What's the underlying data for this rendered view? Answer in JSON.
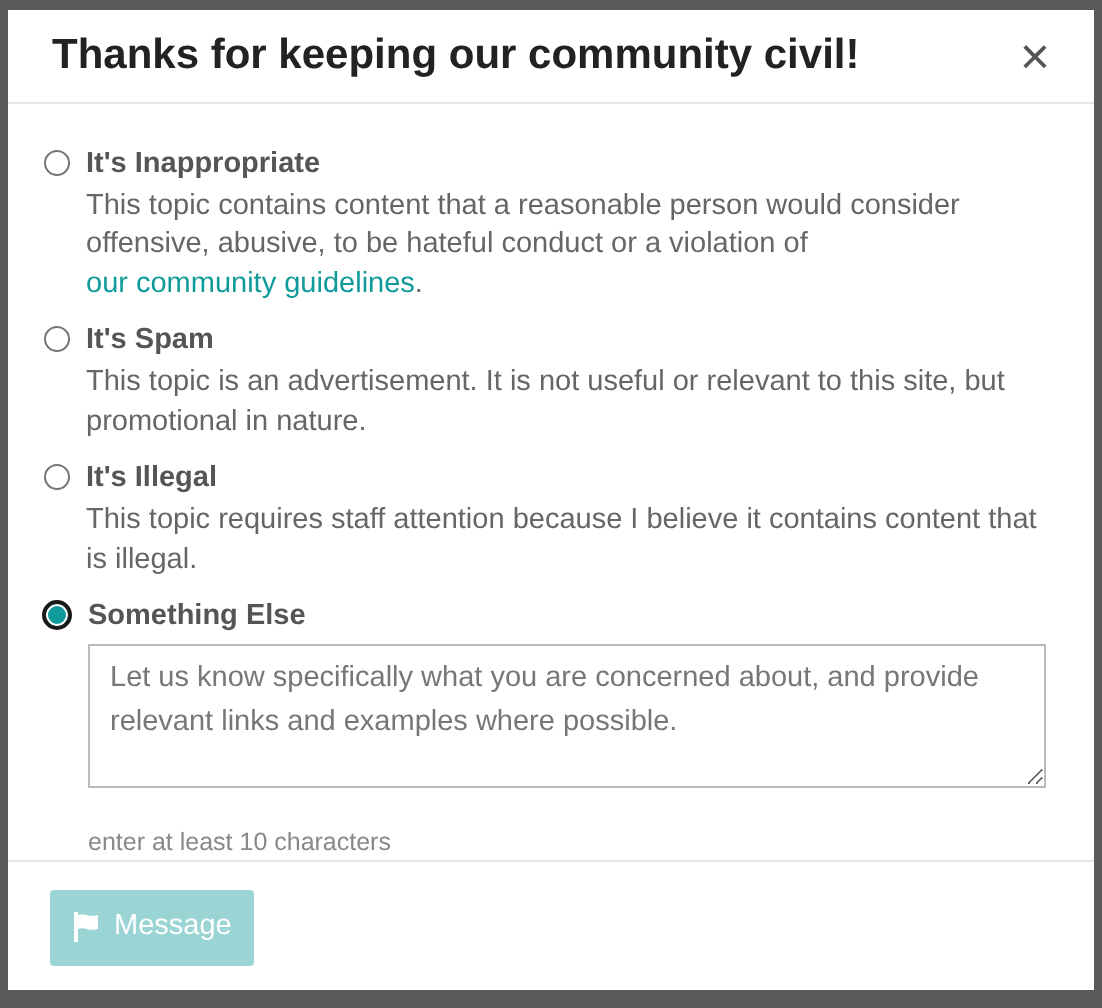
{
  "dialog": {
    "title": "Thanks for keeping our community civil!",
    "close": "×"
  },
  "options": [
    {
      "kind": "text",
      "label": "It's Inappropriate",
      "selected": false,
      "description": "This topic contains content that a reasonable person would consider offensive, abusive, to be hateful conduct or a violation of ",
      "link": "our community guidelines",
      "description_end": "."
    },
    {
      "kind": "text",
      "label": "It's Spam",
      "selected": false,
      "description": "This topic is an advertisement. It is not useful or relevant to this site, but promotional in nature."
    },
    {
      "kind": "text",
      "label": "It's Illegal",
      "selected": false,
      "description": "This topic requires staff attention because I believe it contains content that is illegal."
    },
    {
      "kind": "input",
      "label": "Something Else",
      "selected": true,
      "placeholder": "Let us know specifically what you are concerned about, and provide relevant links and examples where possible.",
      "hint": "enter at least 10 characters"
    }
  ],
  "submit": {
    "label": "Message",
    "disabled": true
  }
}
